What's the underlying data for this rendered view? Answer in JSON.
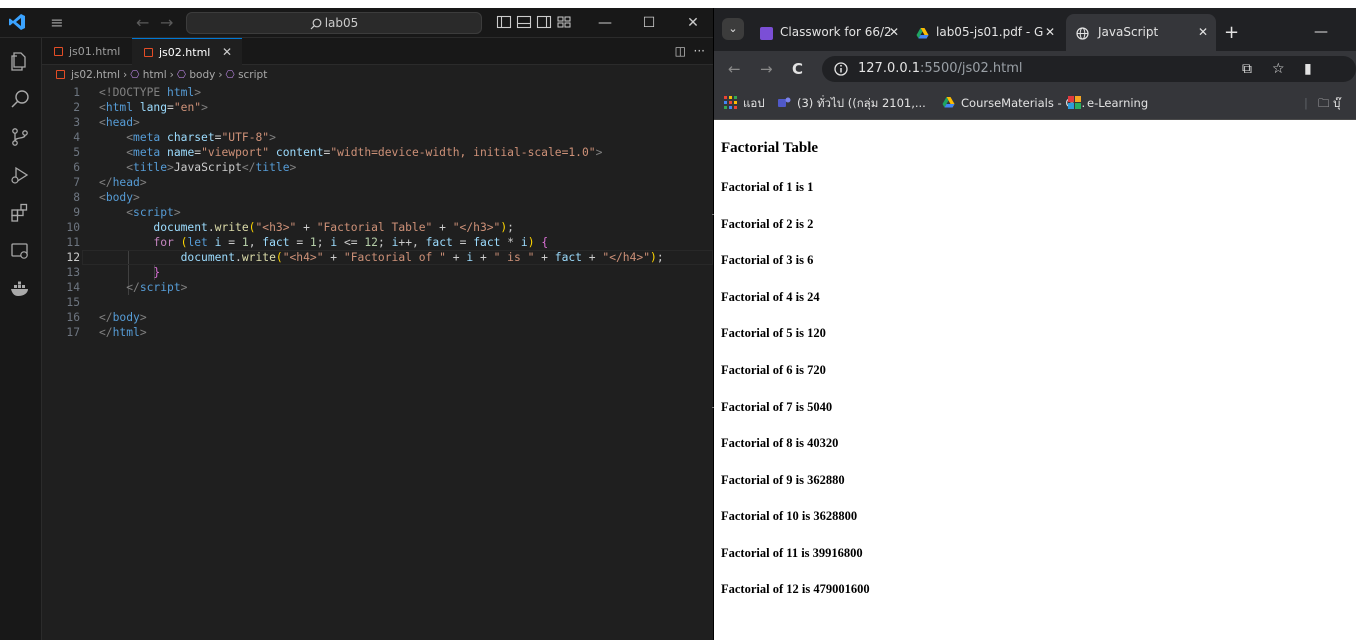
{
  "vscode": {
    "search": "lab05",
    "tabs": [
      {
        "label": "js01.html"
      },
      {
        "label": "js02.html",
        "close": "✕"
      }
    ],
    "breadcrumb": [
      "js02.html",
      "html",
      "body",
      "script"
    ],
    "line_numbers": [
      "1",
      "2",
      "3",
      "4",
      "5",
      "6",
      "7",
      "8",
      "9",
      "10",
      "11",
      "12",
      "13",
      "14",
      "15",
      "16",
      "17"
    ],
    "code": {
      "l1": {
        "a": "<!DOCTYPE ",
        "b": "html",
        "c": ">"
      },
      "l2": {
        "lt": "<",
        "tag": "html",
        "attr": " lang",
        "eq": "=",
        "val": "\"en\"",
        "gt": ">"
      },
      "l3": {
        "lt": "<",
        "tag": "head",
        "gt": ">"
      },
      "l4": {
        "lt": "<",
        "tag": "meta",
        "attr": " charset",
        "eq": "=",
        "val": "\"UTF-8\"",
        "gt": ">"
      },
      "l5": {
        "lt": "<",
        "tag": "meta",
        "attr1": " name",
        "eq1": "=",
        "val1": "\"viewport\"",
        "attr2": " content",
        "eq2": "=",
        "val2": "\"width=device-width, initial-scale=1.0\"",
        "gt": ">"
      },
      "l6": {
        "lt": "<",
        "tag": "title",
        "gt": ">",
        "text": "JavaScript",
        "lt2": "</",
        "tag2": "title",
        "gt2": ">"
      },
      "l7": {
        "lt": "</",
        "tag": "head",
        "gt": ">"
      },
      "l8": {
        "lt": "<",
        "tag": "body",
        "gt": ">"
      },
      "l9": {
        "lt": "<",
        "tag": "script",
        "gt": ">"
      },
      "l10": {
        "obj": "document",
        "dot": ".",
        "fn": "write",
        "p1": "(",
        "s1": "\"<h3>\"",
        "op1": " + ",
        "s2": "\"Factorial Table\"",
        "op2": " + ",
        "s3": "\"</h3>\"",
        "p2": ")",
        "semi": ";"
      },
      "l11": {
        "kw": "for",
        "sp": " ",
        "p1": "(",
        "decl": "let",
        "v1": " i",
        "t1": " = ",
        "n1": "1",
        "t2": ", ",
        "v2": "fact",
        "t3": " = ",
        "n2": "1",
        "t4": "; ",
        "v3": "i",
        "t5": " <= ",
        "n3": "12",
        "t6": "; ",
        "v4": "i",
        "t7": "++, ",
        "v5": "fact",
        "t8": " = ",
        "v6": "fact",
        "t9": " * ",
        "v7": "i",
        "p2": ")",
        "sp2": " ",
        "br": "{"
      },
      "l12": {
        "obj": "document",
        "dot": ".",
        "fn": "write",
        "p1": "(",
        "s1": "\"<h4>\"",
        "op1": " + ",
        "s2": "\"Factorial of \"",
        "op2": " + ",
        "v1": "i",
        "op3": " + ",
        "s3": "\" is \"",
        "op4": " + ",
        "v2": "fact",
        "op5": " + ",
        "s4": "\"</h4>\"",
        "p2": ")",
        "semi": ";"
      },
      "l13": {
        "br": "}"
      },
      "l14": {
        "lt": "</",
        "tag": "script",
        "gt": ">"
      },
      "l16": {
        "lt": "</",
        "tag": "body",
        "gt": ">"
      },
      "l17": {
        "lt": "</",
        "tag": "html",
        "gt": ">"
      }
    }
  },
  "chrome": {
    "tabs": [
      {
        "label": "Classwork for 66/2",
        "close": "✕"
      },
      {
        "label": "lab05-js01.pdf - G",
        "close": "✕"
      },
      {
        "label": "JavaScript",
        "close": "✕"
      }
    ],
    "new_tab": "+",
    "url_host": "127.0.0.1",
    "url_rest": ":5500/js02.html",
    "bookmarks": [
      {
        "label": "แอป"
      },
      {
        "label": "(3) ทั่วไป ((กลุ่ม 2101,..."
      },
      {
        "label": "CourseMaterials - G..."
      },
      {
        "label": "e-Learning"
      },
      {
        "label": "บุ๊"
      }
    ]
  },
  "page": {
    "heading": "Factorial Table",
    "rows": [
      "Factorial of 1 is 1",
      "Factorial of 2 is 2",
      "Factorial of 3 is 6",
      "Factorial of 4 is 24",
      "Factorial of 5 is 120",
      "Factorial of 6 is 720",
      "Factorial of 7 is 5040",
      "Factorial of 8 is 40320",
      "Factorial of 9 is 362880",
      "Factorial of 10 is 3628800",
      "Factorial of 11 is 39916800",
      "Factorial of 12 is 479001600"
    ]
  }
}
